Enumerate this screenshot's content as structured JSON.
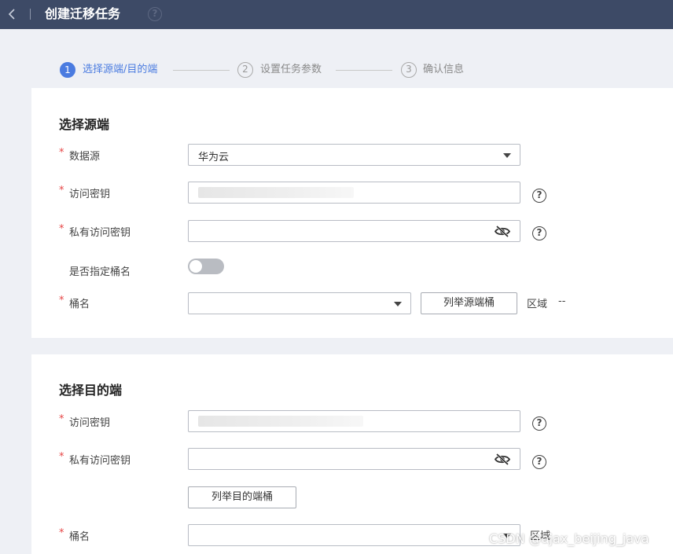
{
  "header": {
    "title": "创建迁移任务",
    "help_glyph": "?"
  },
  "steps": [
    {
      "num": "1",
      "label": "选择源端/目的端",
      "state": "active"
    },
    {
      "num": "2",
      "label": "设置任务参数",
      "state": "inactive"
    },
    {
      "num": "3",
      "label": "确认信息",
      "state": "inactive"
    }
  ],
  "source": {
    "title": "选择源端",
    "data_source_label": "数据源",
    "data_source_value": "华为云",
    "access_key_label": "访问密钥",
    "secret_key_label": "私有访问密钥",
    "specify_bucket_label": "是否指定桶名",
    "bucket_label": "桶名",
    "list_buckets_button": "列举源端桶",
    "region_label": "区域",
    "region_value": "--"
  },
  "destination": {
    "title": "选择目的端",
    "access_key_label": "访问密钥",
    "secret_key_label": "私有访问密钥",
    "list_buckets_button": "列举目的端桶",
    "bucket_label": "桶名",
    "region_label": "区域"
  },
  "required_mark": "*",
  "help_glyph": "?",
  "watermark": "CSDN @ajax_beijing_java",
  "colors": {
    "topbar": "#3d4a66",
    "accent": "#4a7be0",
    "required": "#e64545"
  }
}
